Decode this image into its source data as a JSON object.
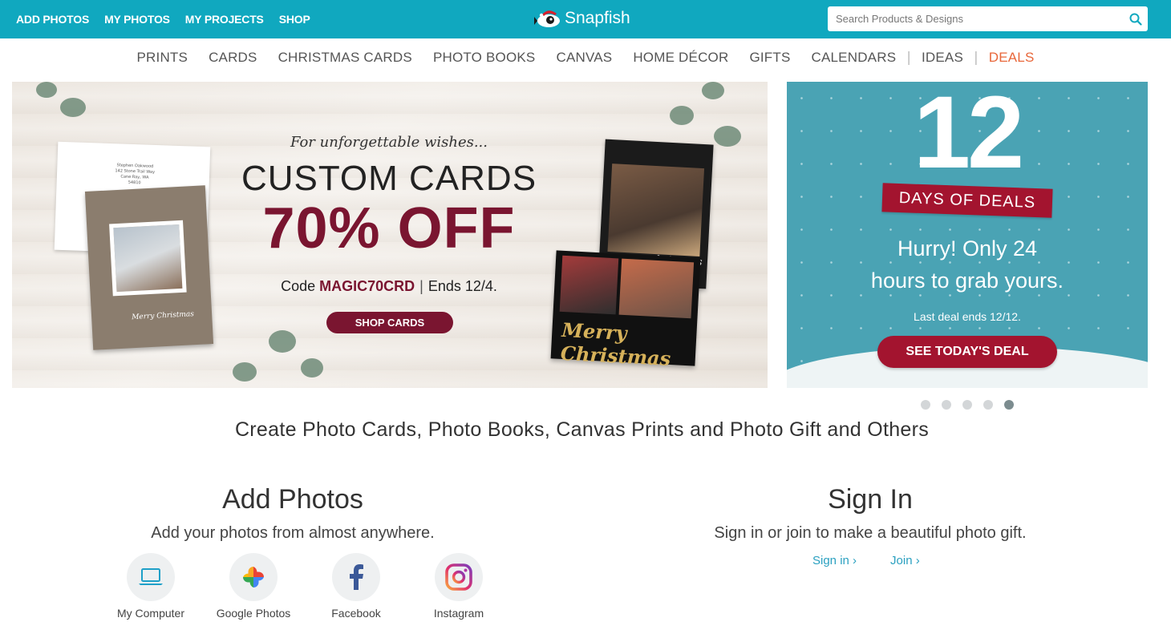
{
  "header": {
    "nav": [
      "ADD PHOTOS",
      "MY PHOTOS",
      "MY PROJECTS",
      "SHOP"
    ],
    "logo_text": "Snapfish",
    "search_placeholder": "Search Products & Designs",
    "bg_color": "#10a8bf"
  },
  "categories": {
    "items": [
      "PRINTS",
      "CARDS",
      "CHRISTMAS CARDS",
      "PHOTO BOOKS",
      "CANVAS",
      "HOME DÉCOR",
      "GIFTS",
      "CALENDARS"
    ],
    "ideas": "IDEAS",
    "deals": "DEALS",
    "deals_color": "#e8673a"
  },
  "hero": {
    "tagline": "For unforgettable wishes...",
    "title": "CUSTOM CARDS",
    "offer": "70% OFF",
    "code_label": "Code",
    "code": "MAGIC70CRD",
    "ends": "Ends 12/4.",
    "button": "SHOP CARDS",
    "accent_color": "#7a1530",
    "envelope_lines": [
      "Stephen Oakwood",
      "142 Stone Trail Way",
      "Cane Ray, WA 54810"
    ],
    "card_left_script": "Merry Christmas",
    "card_right_script": "merry christmas",
    "card_bottom_script": "Merry Christmas"
  },
  "side_banner": {
    "number": "12",
    "ribbon": "DAYS OF DEALS",
    "hurry_line1": "Hurry! Only 24",
    "hurry_line2": "hours to grab yours.",
    "last_deal": "Last deal ends 12/12.",
    "button": "SEE TODAY'S DEAL",
    "bg_color": "#4aa3b4"
  },
  "carousel": {
    "count": 5,
    "active": 5
  },
  "tagline": "Create Photo Cards, Photo Books, Canvas Prints and Photo Gift and Others",
  "add_photos": {
    "title": "Add Photos",
    "subtitle": "Add your photos from almost anywhere.",
    "sources": [
      {
        "label": "My Computer",
        "icon": "laptop-icon"
      },
      {
        "label": "Google Photos",
        "icon": "google-photos-icon"
      },
      {
        "label": "Facebook",
        "icon": "facebook-icon"
      },
      {
        "label": "Instagram",
        "icon": "instagram-icon"
      }
    ]
  },
  "sign_in": {
    "title": "Sign In",
    "subtitle": "Sign in or join to make a beautiful photo gift.",
    "sign_in_link": "Sign in",
    "join_link": "Join"
  }
}
